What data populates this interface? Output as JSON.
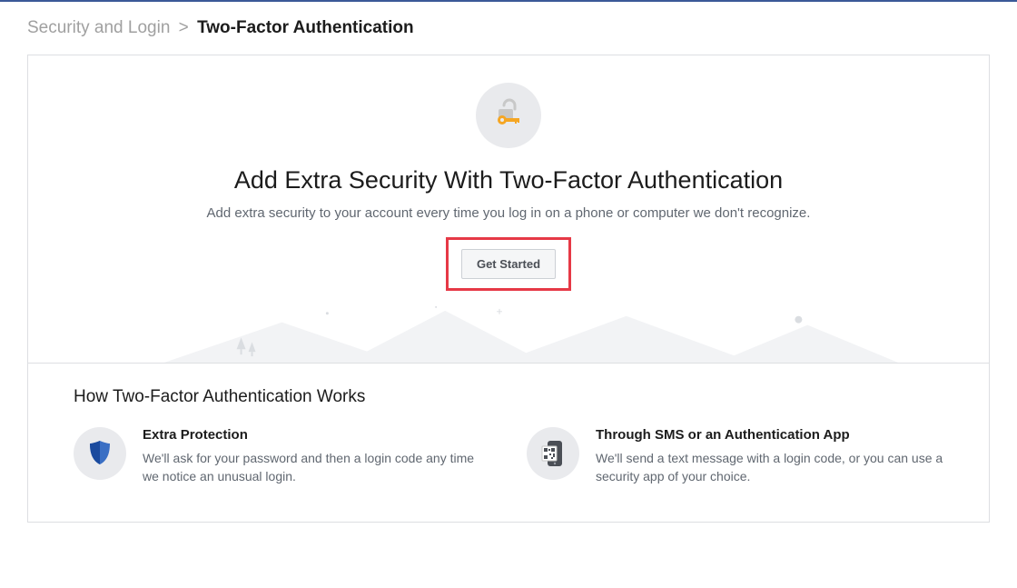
{
  "breadcrumb": {
    "parent": "Security and Login",
    "separator": ">",
    "current": "Two-Factor Authentication"
  },
  "hero": {
    "icon": "lock-key-icon",
    "title": "Add Extra Security With Two-Factor Authentication",
    "subtitle": "Add extra security to your account every time you log in on a phone or computer we don't recognize.",
    "button_label": "Get Started"
  },
  "how_section": {
    "title": "How Two-Factor Authentication Works",
    "features": [
      {
        "icon": "shield-icon",
        "title": "Extra Protection",
        "desc": "We'll ask for your password and then a login code any time we notice an unusual login."
      },
      {
        "icon": "phone-qr-icon",
        "title": "Through SMS or an Authentication App",
        "desc": "We'll send a text message with a login code, or you can use a security app of your choice."
      }
    ]
  }
}
